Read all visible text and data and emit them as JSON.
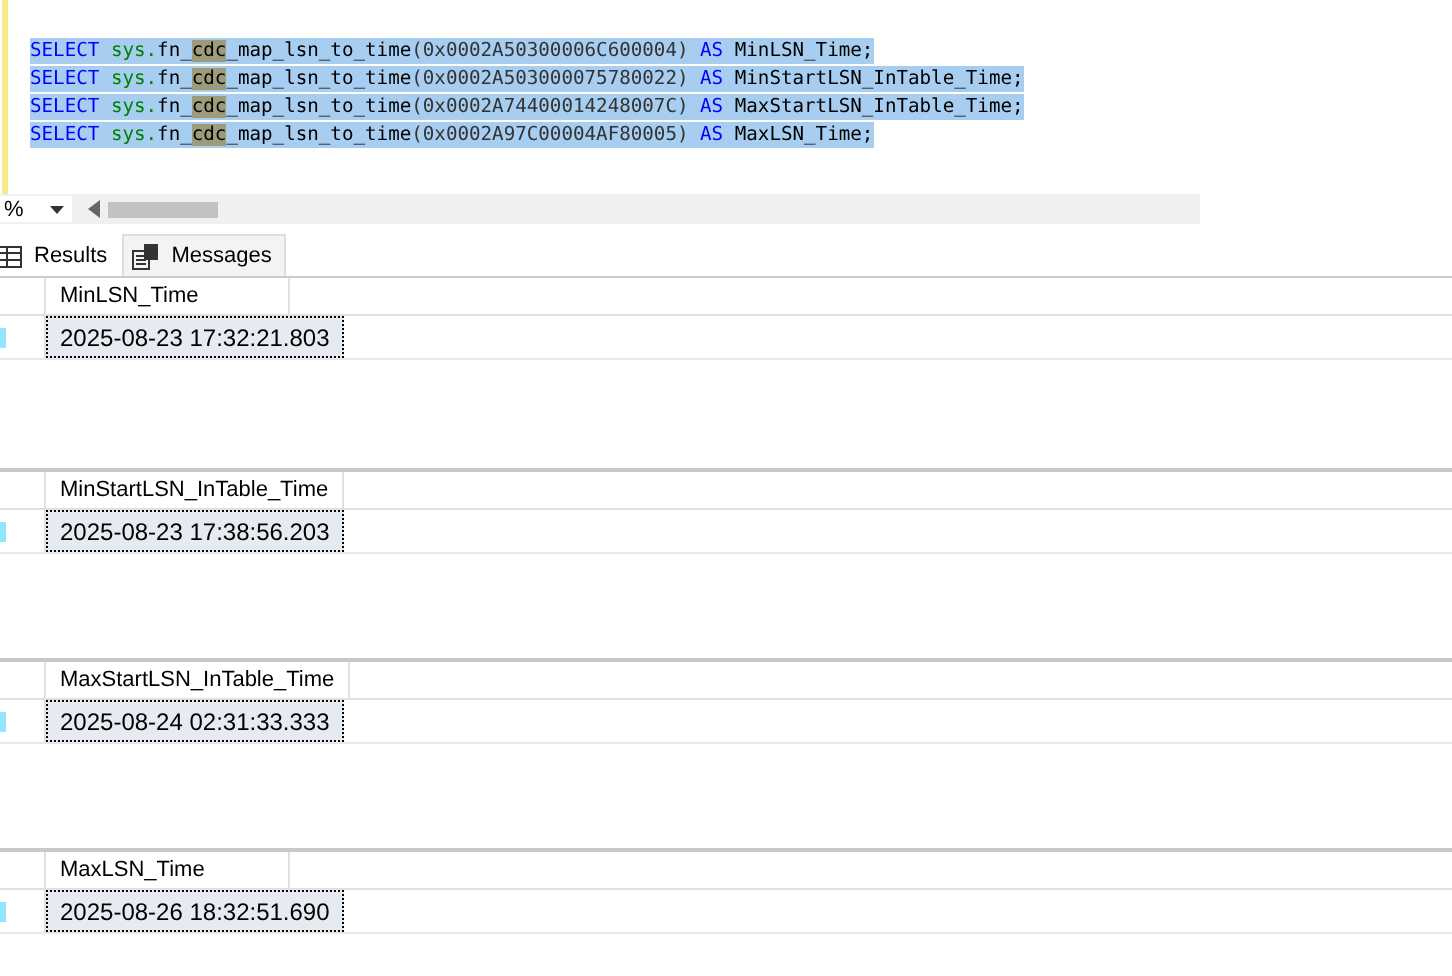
{
  "editor": {
    "lines": [
      {
        "keyword": "SELECT",
        "schema": "sys.",
        "function_prefix": "fn_",
        "function_match": "cdc",
        "function_suffix": "_map_lsn_to_time",
        "argument": "(0x0002A50300006C600004)",
        "as": "AS",
        "alias": "MinLSN_Time;",
        "selected": true
      },
      {
        "keyword": "SELECT",
        "schema": "sys.",
        "function_prefix": "fn_",
        "function_match": "cdc",
        "function_suffix": "_map_lsn_to_time",
        "argument": "(0x0002A503000075780022)",
        "as": "AS",
        "alias": "MinStartLSN_InTable_Time;",
        "selected": true
      },
      {
        "keyword": "SELECT",
        "schema": "sys.",
        "function_prefix": "fn_",
        "function_match": "cdc",
        "function_suffix": "_map_lsn_to_time",
        "argument": "(0x0002A74400014248007C)",
        "as": "AS",
        "alias": "MaxStartLSN_InTable_Time;",
        "selected": true
      },
      {
        "keyword": "SELECT",
        "schema": "sys.",
        "function_prefix": "fn_",
        "function_match": "cdc",
        "function_suffix": "_map_lsn_to_time",
        "argument": "(0x0002A97C00004AF80005)",
        "as": "AS",
        "alias": "MaxLSN_Time;",
        "selected": true
      }
    ]
  },
  "zoom": {
    "value": "%"
  },
  "tabs": [
    {
      "label": "Results",
      "selected": true
    },
    {
      "label": "Messages",
      "selected": false
    }
  ],
  "results": [
    {
      "column": "MinLSN_Time",
      "value": "2025-08-23 17:32:21.803"
    },
    {
      "column": "MinStartLSN_InTable_Time",
      "value": "2025-08-23 17:38:56.203"
    },
    {
      "column": "MaxStartLSN_InTable_Time",
      "value": "2025-08-24 02:31:33.333"
    },
    {
      "column": "MaxLSN_Time",
      "value": "2025-08-26 18:32:51.690"
    }
  ]
}
